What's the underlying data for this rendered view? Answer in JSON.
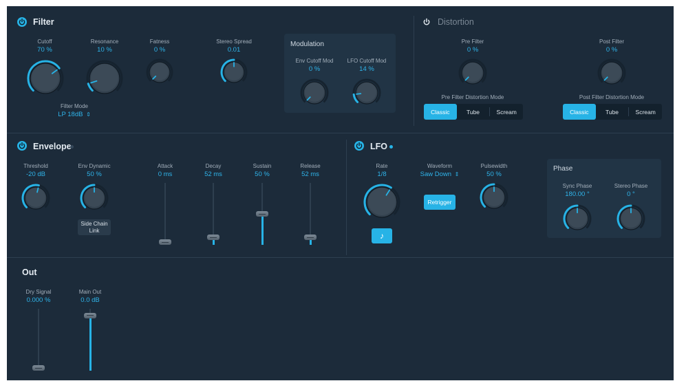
{
  "filter": {
    "title": "Filter",
    "params": [
      {
        "key": "cutoff",
        "label": "Cutoff",
        "value": "70 %",
        "norm": 0.7
      },
      {
        "key": "resonance",
        "label": "Resonance",
        "value": "10 %",
        "norm": 0.1
      },
      {
        "key": "fatness",
        "label": "Fatness",
        "value": "0 %",
        "norm": 0.0
      },
      {
        "key": "stereo-spread",
        "label": "Stereo Spread",
        "value": "0.01",
        "norm": 0.5
      }
    ],
    "mode_label": "Filter Mode",
    "mode_value": "LP 18dB",
    "mode_chevron": "⌃",
    "modulation": {
      "title": "Modulation",
      "params": [
        {
          "key": "env-cutoff-mod",
          "label": "Env Cutoff Mod",
          "value": "0 %",
          "norm": 0.0
        },
        {
          "key": "lfo-cutoff-mod",
          "label": "LFO Cutoff Mod",
          "value": "14 %",
          "norm": 0.14
        }
      ]
    }
  },
  "distortion": {
    "title": "Distortion",
    "pre_filter": {
      "label": "Pre Filter",
      "value": "0 %",
      "norm": 0.0
    },
    "post_filter": {
      "label": "Post Filter",
      "value": "0 %",
      "norm": 0.0
    },
    "pre_mode_label": "Pre Filter Distortion Mode",
    "post_mode_label": "Post Filter Distortion Mode",
    "modes": [
      "Classic",
      "Tube",
      "Scream"
    ],
    "pre_selected": "Classic",
    "post_selected": "Classic"
  },
  "envelope": {
    "title": "Envelope",
    "threshold": {
      "label": "Threshold",
      "value": "-20 dB",
      "norm": 0.55
    },
    "env_dynamic": {
      "label": "Env Dynamic",
      "value": "50 %",
      "norm": 0.5
    },
    "side_chain_line1": "Side Chain",
    "side_chain_line2": "Link",
    "sliders": [
      {
        "key": "attack",
        "label": "Attack",
        "value": "0 ms",
        "norm": 0.0
      },
      {
        "key": "decay",
        "label": "Decay",
        "value": "52 ms",
        "norm": 0.08
      },
      {
        "key": "sustain",
        "label": "Sustain",
        "value": "50 %",
        "norm": 0.5
      },
      {
        "key": "release",
        "label": "Release",
        "value": "52 ms",
        "norm": 0.08
      }
    ]
  },
  "lfo": {
    "title": "LFO",
    "rate": {
      "label": "Rate",
      "value": "1/8",
      "norm": 0.62
    },
    "sync_icon": "note-icon",
    "waveform_label": "Waveform",
    "waveform_value": "Saw Down",
    "waveform_chevron": "⌃",
    "retrigger_label": "Retrigger",
    "pulsewidth": {
      "label": "Pulsewidth",
      "value": "50 %",
      "norm": 0.5
    },
    "phase": {
      "title": "Phase",
      "sync_phase": {
        "label": "Sync Phase",
        "value": "180.00 °",
        "norm": 0.5
      },
      "stereo_phase": {
        "label": "Stereo Phase",
        "value": "0 °",
        "norm": 0.5
      }
    }
  },
  "out": {
    "title": "Out",
    "dry_signal": {
      "label": "Dry Signal",
      "value": "0.000 %",
      "norm": 0.0
    },
    "main_out": {
      "label": "Main Out",
      "value": "0.0 dB",
      "norm": 0.93
    }
  },
  "colors": {
    "background": "#1c2b3a",
    "accent": "#27b3e6",
    "value_text": "#2fb4ea",
    "label_text": "#a3afbb",
    "panel": "#213445"
  }
}
